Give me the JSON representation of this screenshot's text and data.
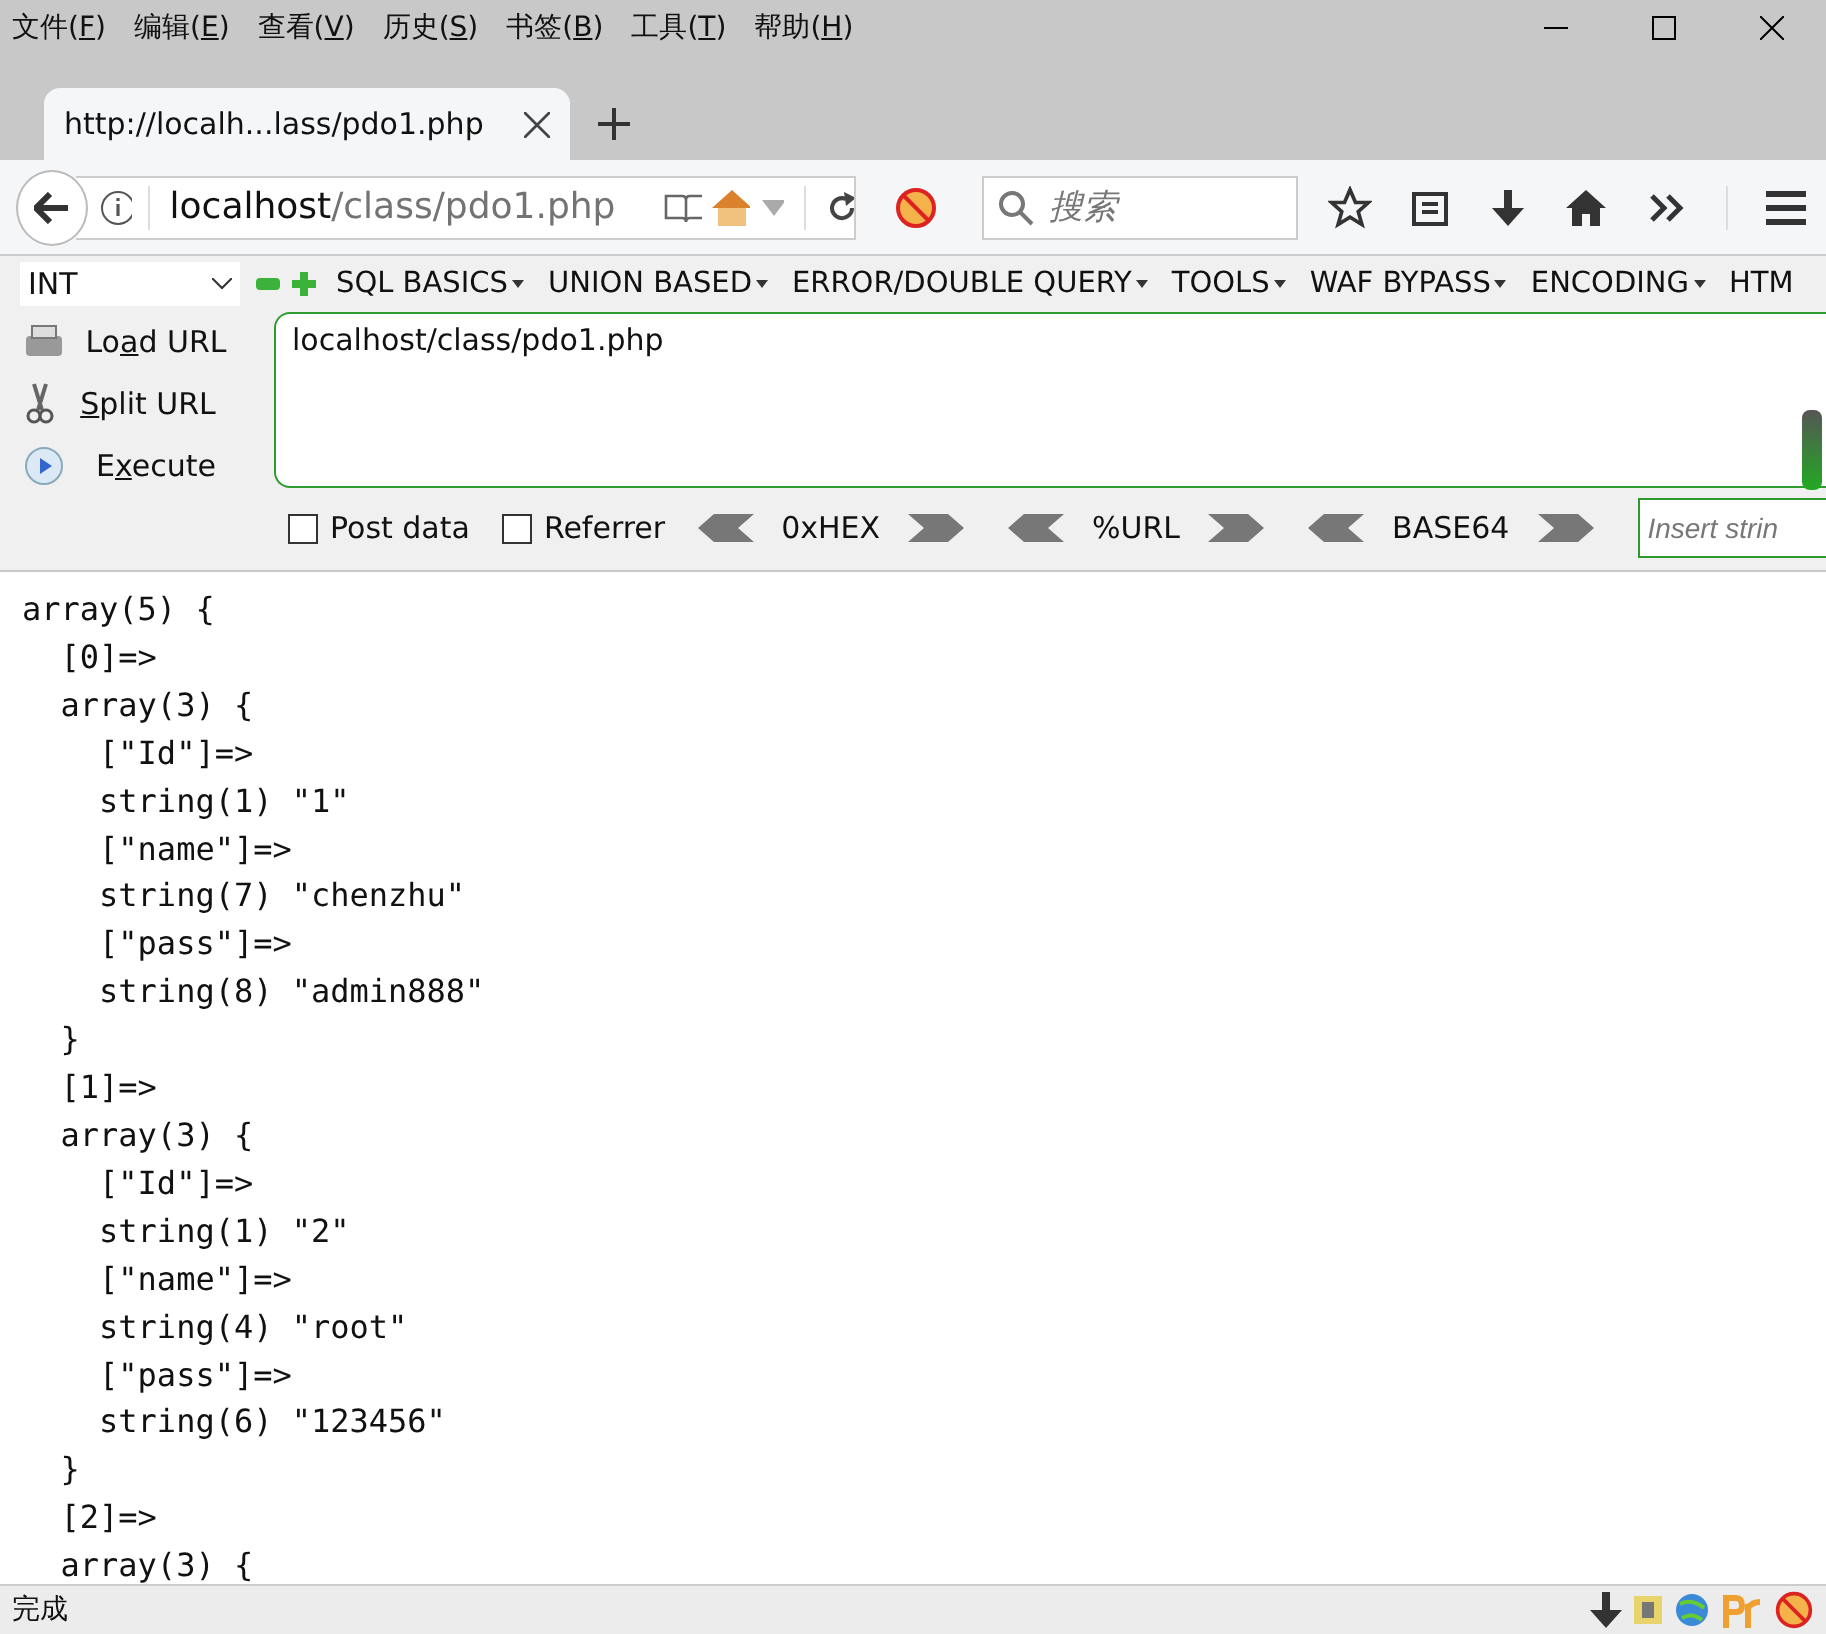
{
  "menu": [
    {
      "pre": "文件(",
      "key": "F",
      "post": ")"
    },
    {
      "pre": "编辑(",
      "key": "E",
      "post": ")"
    },
    {
      "pre": "查看(",
      "key": "V",
      "post": ")"
    },
    {
      "pre": "历史(",
      "key": "S",
      "post": ")"
    },
    {
      "pre": "书签(",
      "key": "B",
      "post": ")"
    },
    {
      "pre": "工具(",
      "key": "T",
      "post": ")"
    },
    {
      "pre": "帮助(",
      "key": "H",
      "post": ")"
    }
  ],
  "tabs": [
    {
      "title": "http://localh...lass/pdo1.php",
      "selected": true
    }
  ],
  "address": {
    "host": "localhost",
    "path": "/class/pdo1.php"
  },
  "search": {
    "placeholder": "搜索"
  },
  "hackbar": {
    "type_select": "INT",
    "menus": [
      "SQL BASICS",
      "UNION BASED",
      "ERROR/DOUBLE QUERY",
      "TOOLS",
      "WAF BYPASS",
      "ENCODING",
      "HTM"
    ],
    "actions": [
      {
        "kind": "load",
        "pre": "Lo",
        "key": "a",
        "post": "d URL"
      },
      {
        "kind": "split",
        "key": "S",
        "post": "plit URL"
      },
      {
        "kind": "execute",
        "pre": "E",
        "key": "x",
        "post": "ecute"
      }
    ],
    "url_text": "localhost/class/pdo1.php",
    "options": [
      {
        "label": "Post data",
        "checked": false
      },
      {
        "label": "Referrer",
        "checked": false
      }
    ],
    "encoders": [
      "0xHEX",
      "%URL",
      "BASE64"
    ],
    "insert_placeholder": "Insert strin"
  },
  "output": [
    "array(5) {",
    "  [0]=>",
    "  array(3) {",
    "    [\"Id\"]=>",
    "    string(1) \"1\"",
    "    [\"name\"]=>",
    "    string(7) \"chenzhu\"",
    "    [\"pass\"]=>",
    "    string(8) \"admin888\"",
    "  }",
    "  [1]=>",
    "  array(3) {",
    "    [\"Id\"]=>",
    "    string(1) \"2\"",
    "    [\"name\"]=>",
    "    string(4) \"root\"",
    "    [\"pass\"]=>",
    "    string(6) \"123456\"",
    "  }",
    "  [2]=>",
    "  array(3) {"
  ],
  "status": "完成"
}
